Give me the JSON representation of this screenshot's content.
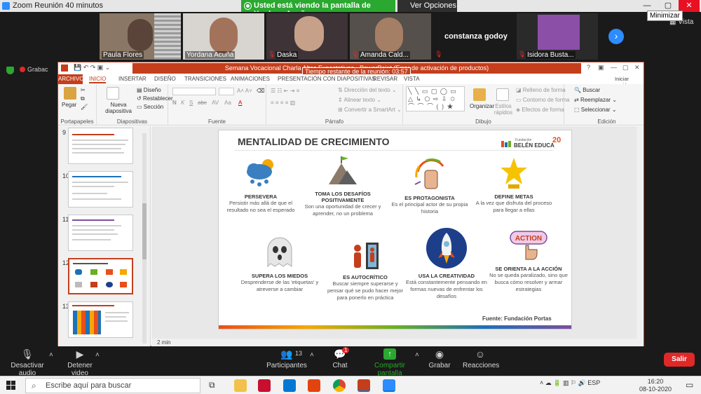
{
  "zoom": {
    "title": "Zoom Reunión 40 minutos",
    "share_banner": "Usted está viendo la pantalla de Yordana Acuña",
    "view_options": "Ver Opciones",
    "minimize_tooltip": "Minimizar",
    "view_label": "Vista",
    "recording_label": "Grabac",
    "participants": [
      {
        "name": "Paula Flores",
        "muted": false,
        "color": "#7a6a5a"
      },
      {
        "name": "Yordana Acuña",
        "muted": false,
        "color": "#6a5648"
      },
      {
        "name": "Daska",
        "muted": true,
        "color": "#4a3f44"
      },
      {
        "name": "Amanda Cald...",
        "muted": true,
        "color": "#55504b"
      },
      {
        "name": "constanza godoy",
        "muted": true,
        "color": "#1a1a1a"
      },
      {
        "name": "Isidora Busta...",
        "muted": true,
        "color": "#8b4fa8"
      }
    ]
  },
  "powerpoint": {
    "window_title": "Semana Vocacional Charla Altas Expectativas - PowerPoint (Error de activación de productos)",
    "countdown": "Tiempo restante de la reunión: 03:57",
    "sign_in": "Iniciar sesión",
    "tabs": [
      "ARCHIVO",
      "INICIO",
      "INSERTAR",
      "DISEÑO",
      "TRANSICIONES",
      "ANIMACIONES",
      "PRESENTACIÓN CON DIAPOSITIVAS",
      "REVISAR",
      "VISTA"
    ],
    "ribbon": {
      "portapapeles": "Portapapeles",
      "pegar": "Pegar",
      "nueva_diapositiva": "Nueva diapositiva",
      "diseno": "Diseño",
      "restablecer": "Restablecer",
      "seccion": "Sección",
      "diapositivas": "Diapositivas",
      "fuente": "Fuente",
      "parrafo": "Párrafo",
      "direccion_texto": "Dirección del texto",
      "alinear_texto": "Alinear texto",
      "convertir_smartart": "Convertir a SmartArt",
      "organizar": "Organizar",
      "estilos_rapidos": "Estilos rápidos",
      "relleno": "Relleno de forma",
      "contorno": "Contorno de forma",
      "efectos": "Efectos de forma",
      "dibujo": "Dibujo",
      "buscar": "Buscar",
      "reemplazar": "Reemplazar",
      "seleccionar": "Seleccionar",
      "edicion": "Edición",
      "font_buttons": [
        "N",
        "K",
        "S",
        "abc",
        "AV",
        "Aa",
        "A"
      ]
    },
    "thumbnail_numbers": [
      "9",
      "10",
      "11",
      "12",
      "13"
    ],
    "status_left": "2 min",
    "slide": {
      "title": "MENTALIDAD DE CRECIMIENTO",
      "brand": "BELÉN EDUCA",
      "brand_sub": "Fundación",
      "brand_years": "20",
      "source": "Fuente: Fundación Portas",
      "action_label": "ACTION",
      "cards": [
        {
          "title": "PERSEVERA",
          "desc": "Persistir más allá de que el resultado no sea el esperado"
        },
        {
          "title": "TOMA LOS DESAFÍOS POSITIVAMENTE",
          "desc": "Son una oportunidad de crecer y aprender, no un problema"
        },
        {
          "title": "ES PROTAGONISTA",
          "desc": "Es el principal actor de su propia historia"
        },
        {
          "title": "DEFINE METAS",
          "desc": "A la vez que disfruta del proceso para llegar a ellas"
        },
        {
          "title": "SUPERA LOS MIEDOS",
          "desc": "Desprenderse de las 'etiquetas' y atreverse a cambiar"
        },
        {
          "title": "ES AUTOCRÍTICO",
          "desc": "Buscar siempre superarse y pensar qué se pudo hacer mejor para ponerlo en práctica"
        },
        {
          "title": "USA LA CREATIVIDAD",
          "desc": "Está constantemente pensando en formas nuevas de enfrentar los desafíos"
        },
        {
          "title": "SE ORIENTA A LA ACCIÓN",
          "desc": "No se queda paralizado, sino que busca cómo resolver y armar estrategias"
        }
      ]
    }
  },
  "controls": {
    "mute": "Desactivar audio",
    "video": "Detener video",
    "participants": "Participantes",
    "participants_count": "13",
    "chat": "Chat",
    "chat_badge": "1",
    "share": "Compartir pantalla",
    "record": "Grabar",
    "reactions": "Reacciones",
    "leave": "Salir"
  },
  "taskbar": {
    "search_placeholder": "Escribe aquí para buscar",
    "lang": "ESP",
    "time": "16:20",
    "date": "08-10-2020"
  }
}
